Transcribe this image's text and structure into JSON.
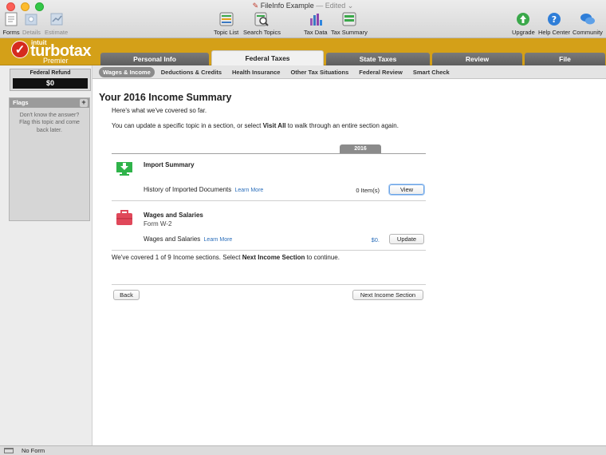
{
  "window": {
    "title": "FileInfo Example",
    "edited": "— Edited ⌄"
  },
  "toolbar": {
    "left": [
      {
        "label": "Forms",
        "icon": "forms-icon",
        "enabled": true
      },
      {
        "label": "Details",
        "icon": "details-icon",
        "enabled": false
      },
      {
        "label": "Estimate",
        "icon": "estimate-icon",
        "enabled": false
      }
    ],
    "center": [
      {
        "label": "Topic List",
        "icon": "topic-list-icon"
      },
      {
        "label": "Search Topics",
        "icon": "search-topics-icon"
      },
      {
        "label": "Tax Data",
        "icon": "tax-data-icon"
      },
      {
        "label": "Tax Summary",
        "icon": "tax-summary-icon"
      }
    ],
    "right": [
      {
        "label": "Upgrade",
        "icon": "upgrade-icon"
      },
      {
        "label": "Help Center",
        "icon": "help-center-icon"
      },
      {
        "label": "Community",
        "icon": "community-icon"
      }
    ]
  },
  "brand": {
    "intuit": "intuit",
    "name": "turbotax",
    "edition": "Premier",
    "check": "✓"
  },
  "main_tabs": [
    "Personal Info",
    "Federal Taxes",
    "State Taxes",
    "Review",
    "File"
  ],
  "active_main_tab": "Federal Taxes",
  "sub_tabs": [
    "Wages & Income",
    "Deductions & Credits",
    "Health Insurance",
    "Other Tax Situations",
    "Federal Review",
    "Smart Check"
  ],
  "active_sub_tab": "Wages & Income",
  "refund": {
    "label": "Federal Refund",
    "amount": "$0"
  },
  "flags": {
    "title": "Flags",
    "add": "+",
    "message": "Don't know the answer? Flag this topic and come back later."
  },
  "content": {
    "title": "Your 2016 Income Summary",
    "intro1": "Here's what we've covered so far.",
    "intro2_pre": "You can update a specific topic in a section, or select ",
    "intro2_bold": "Visit All",
    "intro2_post": " to walk through an entire section again.",
    "year": "2016",
    "sections": [
      {
        "title": "Import Summary",
        "subtitle": "",
        "row_label": "History of Imported Documents",
        "learn_more": "Learn More",
        "value": "0 Item(s)",
        "button": "View"
      },
      {
        "title": "Wages and Salaries",
        "subtitle": "Form W-2",
        "row_label": "Wages and Salaries",
        "learn_more": "Learn More",
        "value": "$0.",
        "button": "Update"
      }
    ],
    "covered_pre": "We've covered 1 of 9 Income sections. Select ",
    "covered_bold": "Next Income Section",
    "covered_post": " to continue.",
    "back_button": "Back",
    "next_button": "Next Income Section"
  },
  "status": {
    "text": "No Form"
  },
  "colors": {
    "brand_gold": "#d4a018",
    "link_blue": "#2a6ebb",
    "tab_gray": "#6b6b6b",
    "import_green": "#2fb34a",
    "wages_red": "#e0485a"
  }
}
